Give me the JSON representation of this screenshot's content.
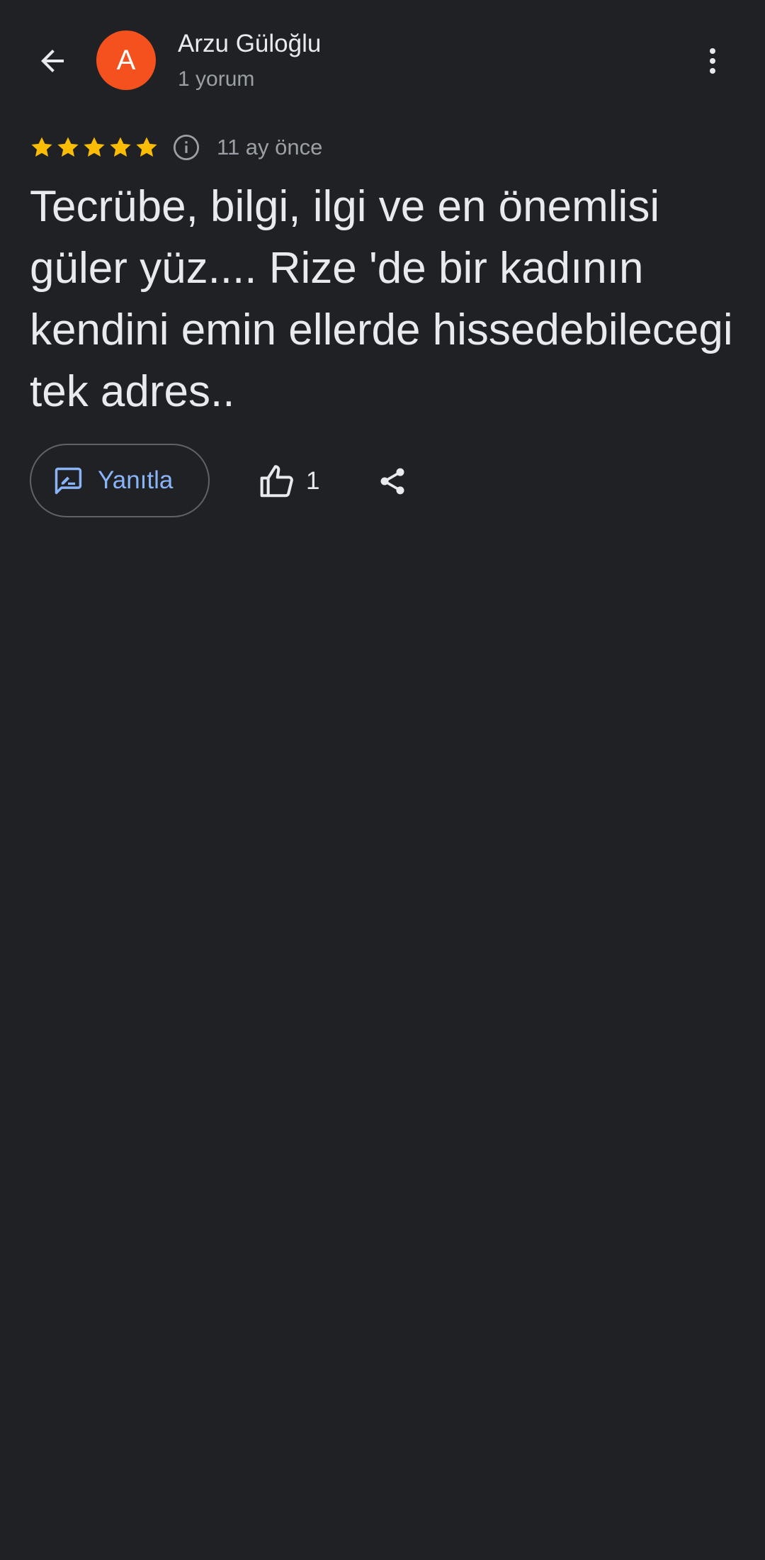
{
  "header": {
    "back_icon": "arrow-back-icon",
    "avatar": {
      "initial": "A",
      "color": "#f4511e"
    },
    "author_name": "Arzu Güloğlu",
    "author_subtitle": "1 yorum",
    "more_icon": "more-vert-icon"
  },
  "review": {
    "rating": 5,
    "rating_max": 5,
    "star_color": "#fbbc04",
    "info_icon": "info-icon",
    "time_ago": "11 ay önce",
    "text": "Tecrübe, bilgi, ilgi ve en önemlisi güler yüz.... Rize 'de bir kadının kendini emin ellerde hissedebilecegi tek adres.."
  },
  "actions": {
    "reply_label": "Yanıtla",
    "reply_icon": "rate-review-icon",
    "like_icon": "thumb-up-icon",
    "like_count": "1",
    "share_icon": "share-icon",
    "accent_color": "#8ab4f8"
  }
}
